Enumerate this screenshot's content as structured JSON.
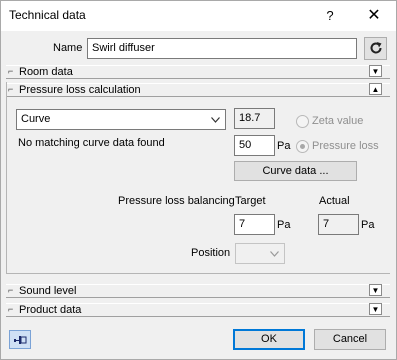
{
  "window": {
    "title": "Technical data",
    "help_glyph": "?",
    "close_glyph": "✕"
  },
  "name_row": {
    "label": "Name",
    "value": "Swirl diffuser"
  },
  "sections": {
    "room_data": "Room data",
    "pressure_loss": "Pressure loss calculation",
    "sound_level": "Sound level",
    "product_data": "Product data"
  },
  "pressure": {
    "method_select": "Curve",
    "curve_value": "18.7",
    "zeta_label": "Zeta value",
    "status_text": "No matching curve data found",
    "pressure_value": "50",
    "pressure_unit": "Pa",
    "pressure_loss_label": "Pressure loss",
    "curve_data_button": "Curve data ...",
    "balancing_label": "Pressure loss balancing",
    "target_label": "Target",
    "actual_label": "Actual",
    "target_value": "7",
    "actual_value": "7",
    "target_unit": "Pa",
    "actual_unit": "Pa",
    "position_label": "Position",
    "position_value": ""
  },
  "footer": {
    "ok": "OK",
    "cancel": "Cancel"
  },
  "icons": {
    "refresh": "refresh-icon",
    "pin": "pin-icon",
    "expand": "chevron-down-icon",
    "collapse": "chevron-up-icon"
  }
}
